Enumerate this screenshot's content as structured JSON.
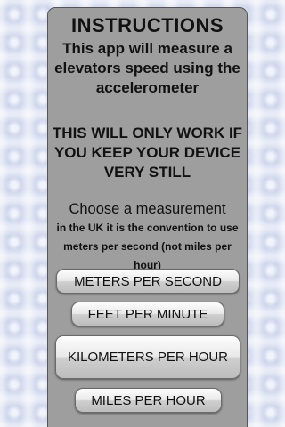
{
  "instructions": {
    "title": "INSTRUCTIONS",
    "intro": "This app will measure a elevators speed using the accelerometer",
    "warning": "THIS WILL ONLY WORK IF YOU KEEP YOUR DEVICE VERY STILL",
    "choose_label": "Choose a measurement",
    "note": "in the UK it is the convention to use meters per second (not miles per hour)"
  },
  "buttons": {
    "meters_per_second": "METERS PER SECOND",
    "feet_per_minute": "FEET PER MINUTE",
    "kilometers_per_hour": "KILOMETERS PER HOUR",
    "miles_per_hour": "MILES PER HOUR"
  },
  "colors": {
    "panel_background": "#9e9e9e",
    "page_background": "#c9d2ea",
    "text": "#111111"
  }
}
